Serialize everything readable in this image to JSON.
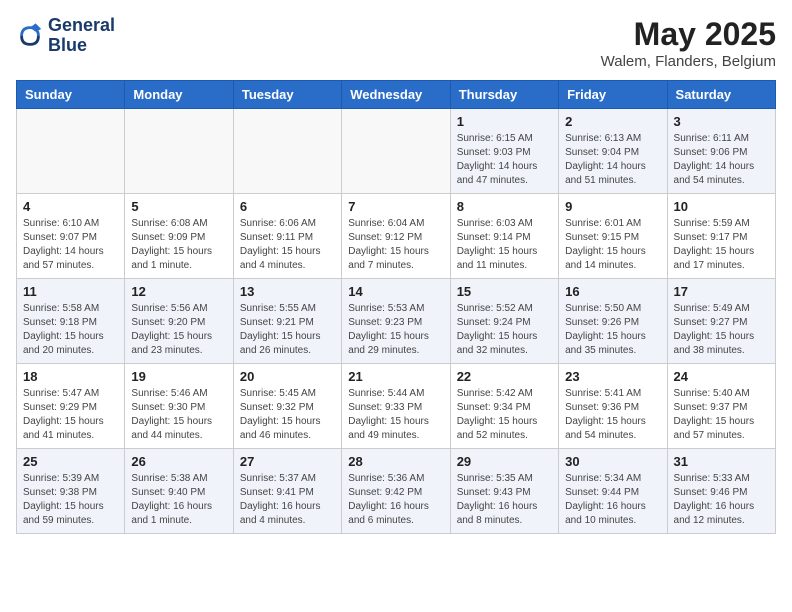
{
  "logo": {
    "line1": "General",
    "line2": "Blue"
  },
  "title": "May 2025",
  "subtitle": "Walem, Flanders, Belgium",
  "days_of_week": [
    "Sunday",
    "Monday",
    "Tuesday",
    "Wednesday",
    "Thursday",
    "Friday",
    "Saturday"
  ],
  "weeks": [
    [
      {
        "num": "",
        "info": ""
      },
      {
        "num": "",
        "info": ""
      },
      {
        "num": "",
        "info": ""
      },
      {
        "num": "",
        "info": ""
      },
      {
        "num": "1",
        "info": "Sunrise: 6:15 AM\nSunset: 9:03 PM\nDaylight: 14 hours and 47 minutes."
      },
      {
        "num": "2",
        "info": "Sunrise: 6:13 AM\nSunset: 9:04 PM\nDaylight: 14 hours and 51 minutes."
      },
      {
        "num": "3",
        "info": "Sunrise: 6:11 AM\nSunset: 9:06 PM\nDaylight: 14 hours and 54 minutes."
      }
    ],
    [
      {
        "num": "4",
        "info": "Sunrise: 6:10 AM\nSunset: 9:07 PM\nDaylight: 14 hours and 57 minutes."
      },
      {
        "num": "5",
        "info": "Sunrise: 6:08 AM\nSunset: 9:09 PM\nDaylight: 15 hours and 1 minute."
      },
      {
        "num": "6",
        "info": "Sunrise: 6:06 AM\nSunset: 9:11 PM\nDaylight: 15 hours and 4 minutes."
      },
      {
        "num": "7",
        "info": "Sunrise: 6:04 AM\nSunset: 9:12 PM\nDaylight: 15 hours and 7 minutes."
      },
      {
        "num": "8",
        "info": "Sunrise: 6:03 AM\nSunset: 9:14 PM\nDaylight: 15 hours and 11 minutes."
      },
      {
        "num": "9",
        "info": "Sunrise: 6:01 AM\nSunset: 9:15 PM\nDaylight: 15 hours and 14 minutes."
      },
      {
        "num": "10",
        "info": "Sunrise: 5:59 AM\nSunset: 9:17 PM\nDaylight: 15 hours and 17 minutes."
      }
    ],
    [
      {
        "num": "11",
        "info": "Sunrise: 5:58 AM\nSunset: 9:18 PM\nDaylight: 15 hours and 20 minutes."
      },
      {
        "num": "12",
        "info": "Sunrise: 5:56 AM\nSunset: 9:20 PM\nDaylight: 15 hours and 23 minutes."
      },
      {
        "num": "13",
        "info": "Sunrise: 5:55 AM\nSunset: 9:21 PM\nDaylight: 15 hours and 26 minutes."
      },
      {
        "num": "14",
        "info": "Sunrise: 5:53 AM\nSunset: 9:23 PM\nDaylight: 15 hours and 29 minutes."
      },
      {
        "num": "15",
        "info": "Sunrise: 5:52 AM\nSunset: 9:24 PM\nDaylight: 15 hours and 32 minutes."
      },
      {
        "num": "16",
        "info": "Sunrise: 5:50 AM\nSunset: 9:26 PM\nDaylight: 15 hours and 35 minutes."
      },
      {
        "num": "17",
        "info": "Sunrise: 5:49 AM\nSunset: 9:27 PM\nDaylight: 15 hours and 38 minutes."
      }
    ],
    [
      {
        "num": "18",
        "info": "Sunrise: 5:47 AM\nSunset: 9:29 PM\nDaylight: 15 hours and 41 minutes."
      },
      {
        "num": "19",
        "info": "Sunrise: 5:46 AM\nSunset: 9:30 PM\nDaylight: 15 hours and 44 minutes."
      },
      {
        "num": "20",
        "info": "Sunrise: 5:45 AM\nSunset: 9:32 PM\nDaylight: 15 hours and 46 minutes."
      },
      {
        "num": "21",
        "info": "Sunrise: 5:44 AM\nSunset: 9:33 PM\nDaylight: 15 hours and 49 minutes."
      },
      {
        "num": "22",
        "info": "Sunrise: 5:42 AM\nSunset: 9:34 PM\nDaylight: 15 hours and 52 minutes."
      },
      {
        "num": "23",
        "info": "Sunrise: 5:41 AM\nSunset: 9:36 PM\nDaylight: 15 hours and 54 minutes."
      },
      {
        "num": "24",
        "info": "Sunrise: 5:40 AM\nSunset: 9:37 PM\nDaylight: 15 hours and 57 minutes."
      }
    ],
    [
      {
        "num": "25",
        "info": "Sunrise: 5:39 AM\nSunset: 9:38 PM\nDaylight: 15 hours and 59 minutes."
      },
      {
        "num": "26",
        "info": "Sunrise: 5:38 AM\nSunset: 9:40 PM\nDaylight: 16 hours and 1 minute."
      },
      {
        "num": "27",
        "info": "Sunrise: 5:37 AM\nSunset: 9:41 PM\nDaylight: 16 hours and 4 minutes."
      },
      {
        "num": "28",
        "info": "Sunrise: 5:36 AM\nSunset: 9:42 PM\nDaylight: 16 hours and 6 minutes."
      },
      {
        "num": "29",
        "info": "Sunrise: 5:35 AM\nSunset: 9:43 PM\nDaylight: 16 hours and 8 minutes."
      },
      {
        "num": "30",
        "info": "Sunrise: 5:34 AM\nSunset: 9:44 PM\nDaylight: 16 hours and 10 minutes."
      },
      {
        "num": "31",
        "info": "Sunrise: 5:33 AM\nSunset: 9:46 PM\nDaylight: 16 hours and 12 minutes."
      }
    ]
  ]
}
